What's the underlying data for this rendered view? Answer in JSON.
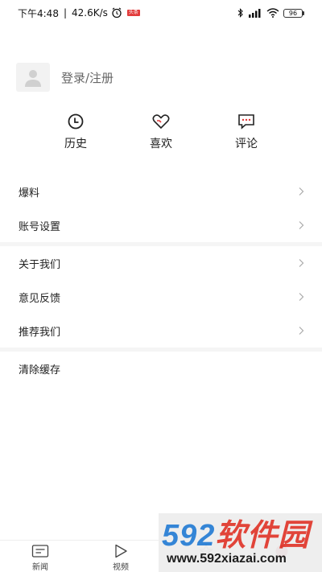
{
  "status_bar": {
    "time": "下午4:48",
    "separator": "|",
    "speed": "42.6K/s",
    "news_badge": "头条",
    "battery": "96",
    "icons": [
      "alarm-icon",
      "bluetooth-icon",
      "signal-icon",
      "wifi-icon",
      "battery-icon"
    ]
  },
  "profile": {
    "login_label": "登录/注册"
  },
  "quick_actions": [
    {
      "label": "历史",
      "icon": "clock-icon"
    },
    {
      "label": "喜欢",
      "icon": "heart-icon"
    },
    {
      "label": "评论",
      "icon": "comment-icon"
    }
  ],
  "menu": {
    "group1": [
      {
        "label": "爆料",
        "chevron": true
      },
      {
        "label": "账号设置",
        "chevron": true
      }
    ],
    "group2": [
      {
        "label": "关于我们",
        "chevron": true
      },
      {
        "label": "意见反馈",
        "chevron": true
      },
      {
        "label": "推荐我们",
        "chevron": true
      }
    ],
    "group3": [
      {
        "label": "清除缓存",
        "chevron": false
      }
    ]
  },
  "bottom_nav": [
    {
      "label": "新闻",
      "icon": "news-icon"
    },
    {
      "label": "视频",
      "icon": "play-icon"
    },
    {
      "label": "",
      "icon": "star-icon"
    },
    {
      "label": "",
      "icon": "profile-icon"
    }
  ],
  "watermark": {
    "brand": "592软件园",
    "url": "www.592xiazai.com"
  },
  "colors": {
    "accent_red": "#e23b3b",
    "watermark_blue": "#2a7fd4",
    "watermark_red": "#e03a2f"
  }
}
